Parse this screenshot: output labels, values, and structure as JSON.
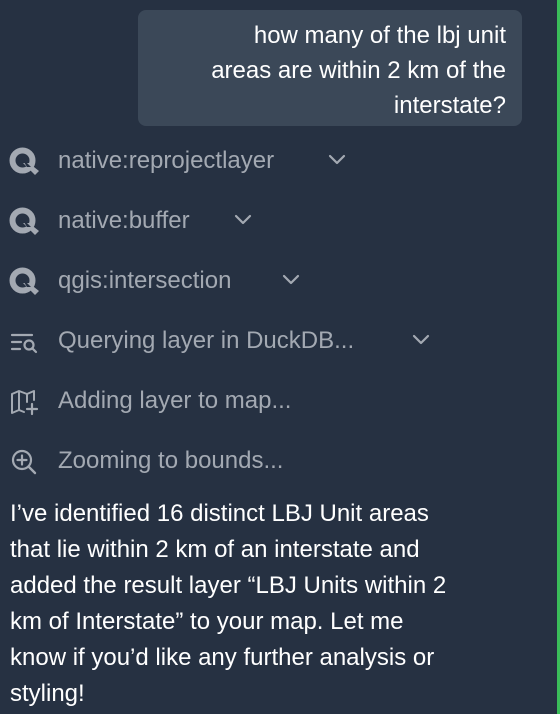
{
  "user_message": {
    "lines": [
      "how many of the lbj unit",
      "areas are within 2 km of the",
      "interstate?"
    ]
  },
  "tool_steps": [
    {
      "label": "native:reprojectlayer",
      "icon": "qgis-logo-icon",
      "expandable": true
    },
    {
      "label": "native:buffer",
      "icon": "qgis-logo-icon",
      "expandable": true
    },
    {
      "label": "qgis:intersection",
      "icon": "qgis-logo-icon",
      "expandable": true
    },
    {
      "label": "Querying layer in DuckDB...",
      "icon": "query-list-icon",
      "expandable": true
    },
    {
      "label": "Adding layer to map...",
      "icon": "map-add-icon",
      "expandable": false
    },
    {
      "label": "Zooming to bounds...",
      "icon": "zoom-in-icon",
      "expandable": false
    }
  ],
  "assistant_message": {
    "lines": [
      "I’ve identified 16 distinct LBJ Unit areas",
      "that lie within 2 km of an interstate and",
      "added the result layer “LBJ Units within 2",
      "km of Interstate” to your map. Let me",
      "know if you’d like any further analysis or",
      "styling!"
    ]
  },
  "colors": {
    "background": "#263142",
    "user_bubble": "#3b4858",
    "step_text": "#a3a9b2",
    "accent_edge": "#3bbd5a"
  }
}
